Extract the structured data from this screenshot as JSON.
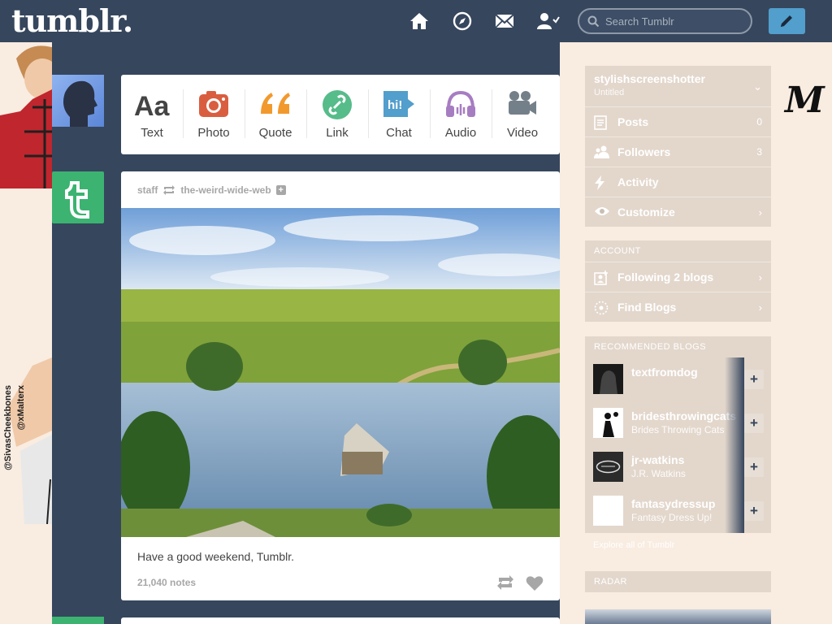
{
  "header": {
    "logo": "tumblr.",
    "search_placeholder": "Search Tumblr",
    "icons": [
      "home-icon",
      "explore-icon",
      "inbox-icon",
      "account-icon",
      "compose-icon"
    ],
    "colors": {
      "bar": "#36465d",
      "compose": "#529ecc"
    }
  },
  "background": {
    "credit_line_1": "@SivasCheekbones",
    "credit_line_2": "@xMalterx",
    "deco_letter": "M"
  },
  "post_types": [
    {
      "label": "Text",
      "icon": "text-icon",
      "color": "#444444"
    },
    {
      "label": "Photo",
      "icon": "camera-icon",
      "color": "#d95e40"
    },
    {
      "label": "Quote",
      "icon": "quote-icon",
      "color": "#f2992e"
    },
    {
      "label": "Link",
      "icon": "link-icon",
      "color": "#56bc8a"
    },
    {
      "label": "Chat",
      "icon": "chat-icon",
      "color": "#529ecc"
    },
    {
      "label": "Audio",
      "icon": "headphones-icon",
      "color": "#a77dc2"
    },
    {
      "label": "Video",
      "icon": "video-camera-icon",
      "color": "#748089"
    }
  ],
  "post": {
    "author": "staff",
    "reblogged_from": "the-weird-wide-web",
    "caption": "Have a good weekend, Tumblr.",
    "notes": "21,040 notes"
  },
  "sidebar": {
    "blog_name": "stylishscreenshotter",
    "blog_title": "Untitled",
    "items": [
      {
        "label": "Posts",
        "count": "0",
        "icon": "posts-icon"
      },
      {
        "label": "Followers",
        "count": "3",
        "icon": "followers-icon"
      },
      {
        "label": "Activity",
        "count": "",
        "icon": "activity-icon"
      },
      {
        "label": "Customize",
        "count": "",
        "icon": "eye-icon"
      }
    ],
    "account_title": "ACCOUNT",
    "account_items": [
      {
        "label": "Following 2 blogs",
        "icon": "following-icon"
      },
      {
        "label": "Find Blogs",
        "icon": "find-blogs-icon"
      }
    ],
    "recommended_title": "RECOMMENDED BLOGS",
    "recommended": [
      {
        "name": "textfromdog",
        "title": ""
      },
      {
        "name": "bridesthrowingcats",
        "title": "Brides Throwing Cats"
      },
      {
        "name": "jr-watkins",
        "title": "J.R. Watkins"
      },
      {
        "name": "fantasydressup",
        "title": "Fantasy Dress Up!"
      }
    ],
    "explore_link": "Explore all of Tumblr",
    "radar_title": "RADAR"
  }
}
